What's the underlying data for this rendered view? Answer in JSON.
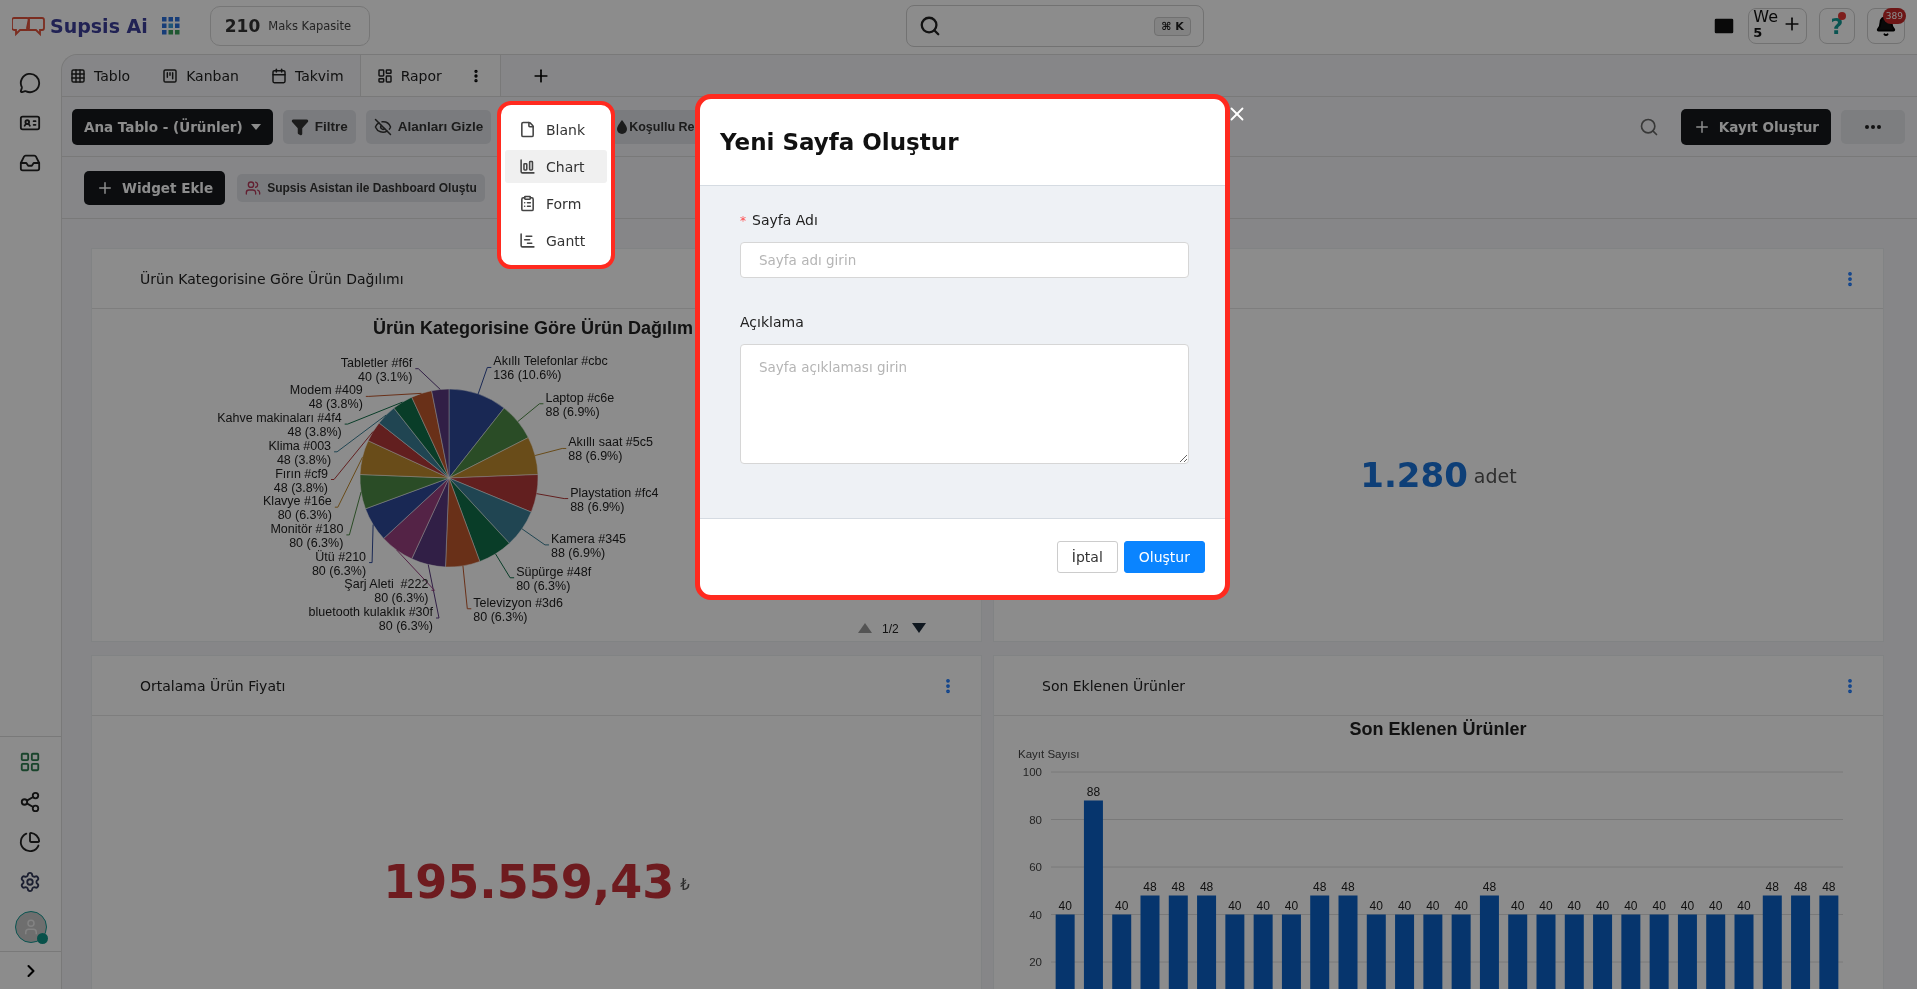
{
  "header": {
    "logo": "Supsis Ai",
    "capacity": {
      "value": "210",
      "label": "Maks Kapasite"
    },
    "search": {
      "shortcut": "⌘ K"
    },
    "workspace": {
      "label": "We",
      "count": "5"
    },
    "help": {
      "label": "?",
      "unread": true
    },
    "notifications": {
      "count": "389"
    }
  },
  "user": {
    "online": true
  },
  "tabs": [
    {
      "label": "Tablo",
      "selected": false
    },
    {
      "label": "Kanban",
      "selected": false
    },
    {
      "label": "Takvim",
      "selected": false
    },
    {
      "label": "Rapor",
      "selected": true
    }
  ],
  "toolbar": {
    "table_select": "Ana Tablo - (Ürünler)",
    "buttons": [
      "Filtre",
      "Alanları Gizle",
      "Koşullu Re"
    ],
    "create_button": "Kayıt Oluştur"
  },
  "widget_bar": {
    "add_button": "Widget Ekle",
    "assistant_button": "Supsis Asistan ile Dashboard Oluştu"
  },
  "widgets": [
    {
      "kind": "chart",
      "title": "Ürün Kategorisine Göre Ürün Dağılımı",
      "chart_data": {
        "type": "pie",
        "title": "Ürün Kategorisine Göre Ürün Dağılım",
        "categories": [
          "Akıllı Telefonlar #cbc",
          "Laptop #c6e",
          "Akıllı saat #5c5",
          "Playstation #fc4",
          "Kamera #345",
          "Süpürge #48f",
          "Televizyon #3d6",
          "bluetooth kulaklık #30f",
          "Şarj Aleti  #222",
          "Ütü #210",
          "Monitör #180",
          "Klavye #16e",
          "Fırın #cf9",
          "Klima #003",
          "Kahve makinaları #4f4",
          "Modem #409",
          "Tabletler #f6f"
        ],
        "values": [
          136,
          88,
          88,
          88,
          88,
          80,
          80,
          80,
          80,
          80,
          80,
          80,
          48,
          48,
          48,
          48,
          40
        ],
        "value_labels": [
          "136 (10.6%)",
          "88 (6.9%)",
          "88 (6.9%)",
          "88 (6.9%)",
          "88 (6.9%)",
          "80 (6.3%)",
          "80 (6.3%)",
          "80 (6.3%)",
          "80 (6.3%)",
          "80 (6.3%)",
          "80 (6.3%)",
          "80 (6.3%)",
          "48 (3.8%)",
          "48 (3.8%)",
          "48 (3.8%)",
          "48 (3.8%)",
          "40 (3.1%)"
        ]
      },
      "legend": {
        "page": "1/2"
      }
    },
    {
      "kind": "count",
      "menu": true,
      "value": "1.280",
      "unit": "adet"
    },
    {
      "kind": "amount",
      "menu": true,
      "title": "Ortalama Ürün Fiyatı",
      "value": "195.559,43",
      "unit": "₺"
    },
    {
      "kind": "chart",
      "menu": true,
      "title": "Son Eklenen Ürünler",
      "chart_data": {
        "type": "bar",
        "title": "Son Eklenen Ürünler",
        "ylabel": "Kayıt Sayısı",
        "values": [
          40,
          88,
          40,
          48,
          48,
          48,
          40,
          40,
          40,
          48,
          48,
          40,
          40,
          40,
          40,
          48,
          40,
          40,
          40,
          40,
          40,
          40,
          40,
          40,
          40,
          48,
          48,
          48
        ],
        "ylim": [
          0,
          100
        ],
        "yticks": [
          20,
          40,
          60,
          80,
          100
        ],
        "grid": true,
        "data_labels": true
      }
    }
  ],
  "page_menu": {
    "items": [
      {
        "label": "Blank",
        "selected": false
      },
      {
        "label": "Chart",
        "selected": true
      },
      {
        "label": "Form",
        "selected": false
      },
      {
        "label": "Gantt",
        "selected": false
      }
    ]
  },
  "modal": {
    "title": "Yeni Sayfa Oluştur",
    "fields": [
      {
        "kind": "input",
        "label": "Sayfa Adı",
        "required_mark": "*",
        "placeholder": "Sayfa adı girin"
      },
      {
        "kind": "textarea",
        "label": "Açıklama",
        "placeholder": "Sayfa açıklaması girin"
      }
    ],
    "buttons": [
      {
        "kind": "secondary",
        "label": "İptal"
      },
      {
        "kind": "primary",
        "label": "Oluştur"
      }
    ]
  }
}
